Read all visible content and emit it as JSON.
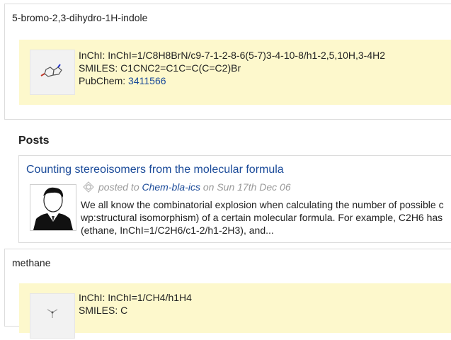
{
  "compound1": {
    "name": "5-bromo-2,3-dihydro-1H-indole",
    "inchi": "InChI: InChI=1/C8H8BrN/c9-7-1-2-8-6(5-7)3-4-10-8/h1-2,5,10H,3-4H2",
    "smiles": "SMILES: C1CNC2=C1C=C(C=C2)Br",
    "pubchem_label": "PubChem: ",
    "pubchem_id": "3411566"
  },
  "posts": {
    "heading": "Posts",
    "items": [
      {
        "title": "Counting stereoisomers from the molecular formula",
        "posted_to": "posted to",
        "blog": "Chem-bla-ics",
        "on": "on",
        "date": "Sun 17th Dec 06",
        "excerpt_lines": [
          "We all know the combinatorial explosion when calculating the number of possible c",
          "wp:structural isomorphism) of a certain molecular formula. For example, C2H6 has",
          "(ethane, InChI=1/C2H6/c1-2/h1-2H3), and..."
        ]
      }
    ]
  },
  "compound2": {
    "name": "methane",
    "inchi": "InChI: InChI=1/CH4/h1H4",
    "smiles": "SMILES: C"
  },
  "colors": {
    "link": "#1a4a99",
    "highlight_bg": "#fdf8cc",
    "border": "#dcdcdc"
  },
  "icons": [
    "molecule-thumbnail",
    "feed-icon",
    "avatar-silhouette"
  ]
}
